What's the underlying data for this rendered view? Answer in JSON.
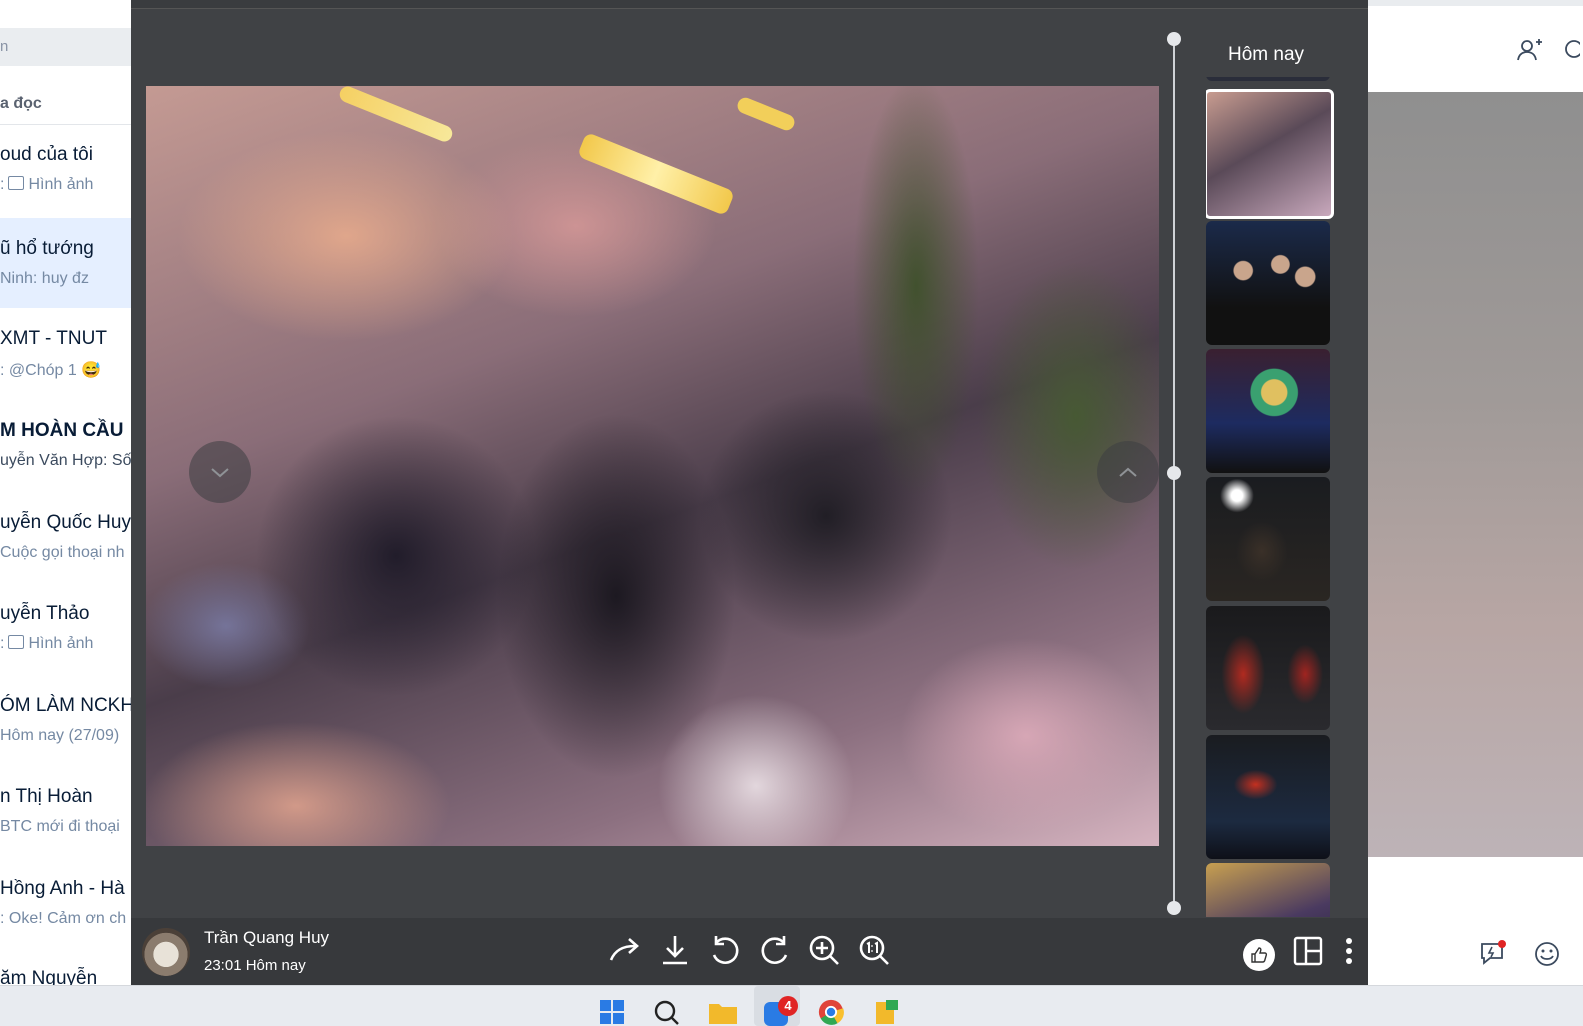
{
  "chat_list": {
    "search_placeholder": "n",
    "filter_label": "a đọc",
    "conversations": [
      {
        "name": "oud của tôi",
        "message": ": Hình ảnh",
        "image_icon": true
      },
      {
        "name": "ũ hổ tướng",
        "message": " Ninh: huy đz",
        "active": true
      },
      {
        "name": "XMT - TNUT",
        "message": ": @Chóp 1 😅"
      },
      {
        "name": "M HOÀN CẦU",
        "message": "uyễn Văn Hợp: Số",
        "bold": true
      },
      {
        "name": "uyễn Quốc Huy",
        "message": "Cuộc gọi thoại nh"
      },
      {
        "name": "uyễn Thảo",
        "message": ": Hình ảnh",
        "image_icon": true
      },
      {
        "name": "ÓM LÀM NCKH",
        "message": "Hôm nay (27/09)"
      },
      {
        "name": "n Thị Hoàn",
        "message": "BTC mới đi thoại"
      },
      {
        "name": "Hồng Anh - Hà",
        "message": ": Oke! Cảm ơn ch"
      },
      {
        "name": "ăm Nguyễn",
        "message": ""
      }
    ]
  },
  "viewer": {
    "strip_title": "Hôm nay",
    "sender_name": "Trần Quang Huy",
    "sent_time": "23:01 Hôm nay",
    "nav": {
      "prev_icon": "chevron-down-icon",
      "next_icon": "chevron-up-icon"
    },
    "toolbar": [
      "share-icon",
      "download-icon",
      "rotate-left-icon",
      "rotate-right-icon",
      "zoom-in-icon",
      "actual-size-icon"
    ],
    "right_actions": [
      "like-icon",
      "layout-icon",
      "more-icon"
    ],
    "thumbnail_count": 7,
    "selected_thumbnail": 0
  },
  "taskbar": {
    "zalo_badge": "4",
    "icons": [
      "windows-start-icon",
      "search-icon",
      "file-explorer-icon",
      "zalo-icon",
      "chrome-icon",
      "app-icon"
    ]
  },
  "colors": {
    "viewer_bg": "#404245",
    "bottom_bar": "#37393c",
    "active_conversation": "#e5efff",
    "badge": "#e02424"
  }
}
